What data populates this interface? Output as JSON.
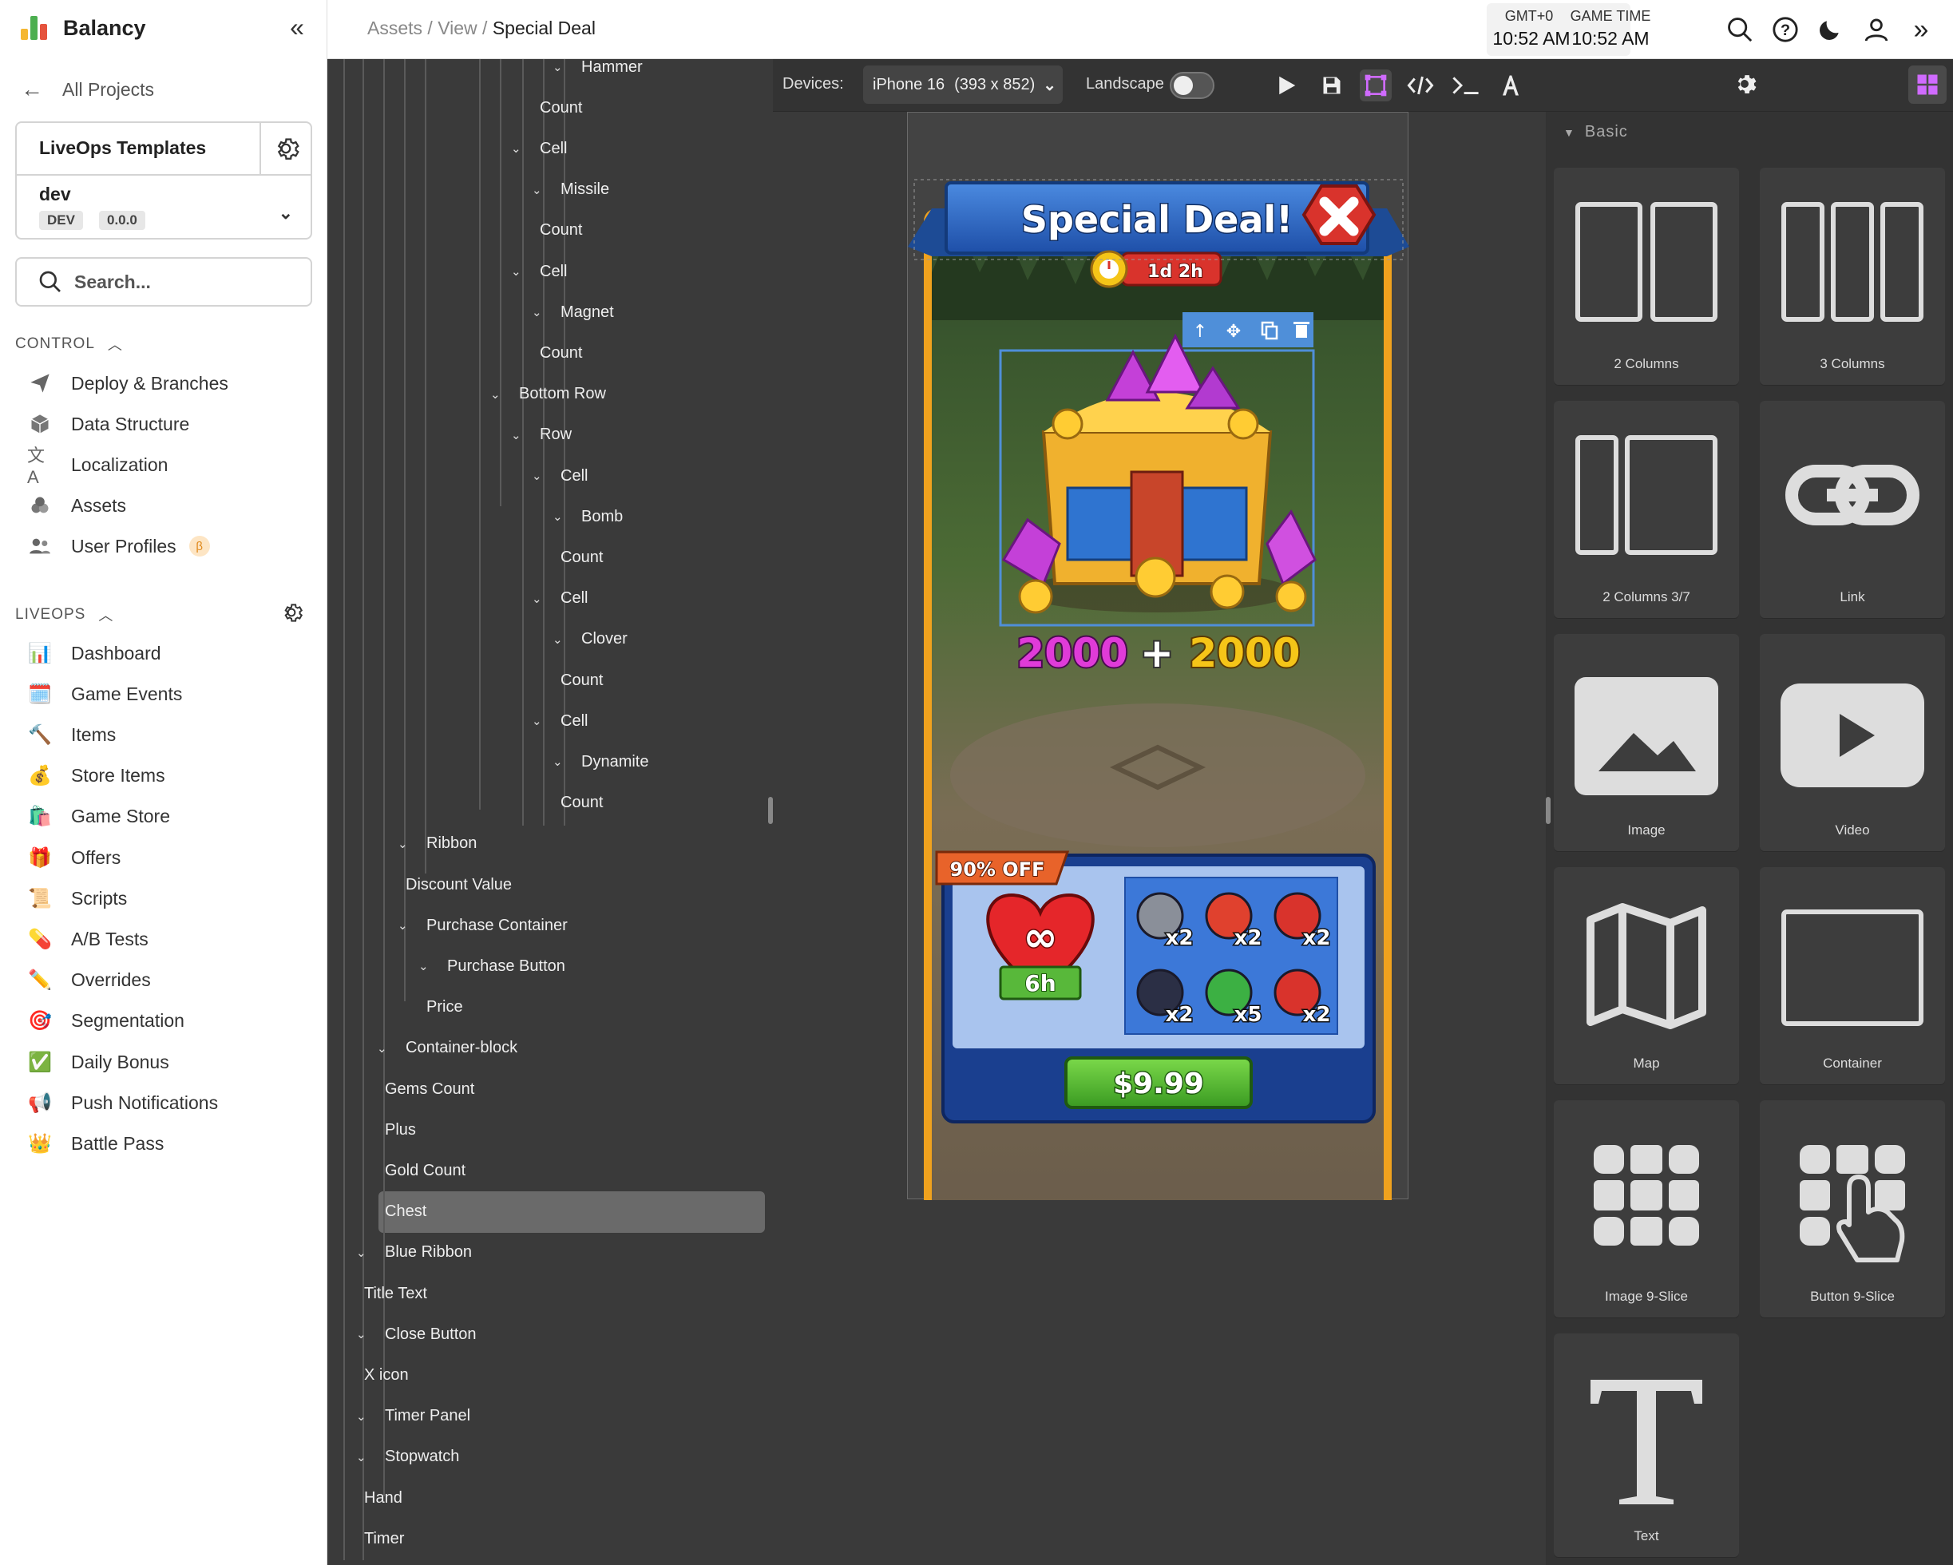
{
  "brand": {
    "name": "Balancy"
  },
  "sidebar": {
    "back_label": "All Projects",
    "project_name": "LiveOps Templates",
    "env_name": "dev",
    "env_badge": "DEV",
    "version_badge": "0.0.0",
    "search_placeholder": "Search...",
    "control_title": "CONTROL",
    "control_items": [
      {
        "label": "Deploy & Branches",
        "icon": "send-icon"
      },
      {
        "label": "Data Structure",
        "icon": "cube-icon"
      },
      {
        "label": "Localization",
        "icon": "translate-icon"
      },
      {
        "label": "Assets",
        "icon": "assets-icon"
      },
      {
        "label": "User Profiles",
        "icon": "users-icon",
        "beta": "β"
      }
    ],
    "liveops_title": "LIVEOPS",
    "liveops_items": [
      {
        "label": "Dashboard",
        "icon": "📊"
      },
      {
        "label": "Game Events",
        "icon": "🗓️"
      },
      {
        "label": "Items",
        "icon": "🔨"
      },
      {
        "label": "Store Items",
        "icon": "💰"
      },
      {
        "label": "Game Store",
        "icon": "🛍️"
      },
      {
        "label": "Offers",
        "icon": "🎁"
      },
      {
        "label": "Scripts",
        "icon": "📜"
      },
      {
        "label": "A/B Tests",
        "icon": "💊"
      },
      {
        "label": "Overrides",
        "icon": "✏️"
      },
      {
        "label": "Segmentation",
        "icon": "🎯"
      },
      {
        "label": "Daily Bonus",
        "icon": "✅"
      },
      {
        "label": "Push Notifications",
        "icon": "📢"
      },
      {
        "label": "Battle Pass",
        "icon": "👑"
      }
    ]
  },
  "topbar": {
    "breadcrumb": [
      "Assets",
      "View",
      "Special Deal"
    ],
    "tz_label": "GMT+0",
    "tz_time": "10:52 AM",
    "game_label": "GAME TIME",
    "game_time": "10:52 AM"
  },
  "tree": {
    "nodes": [
      {
        "label": "Hammer",
        "chev": true
      },
      {
        "label": "Count",
        "chev": false
      },
      {
        "label": "Cell",
        "chev": true
      },
      {
        "label": "Missile",
        "chev": true
      },
      {
        "label": "Count",
        "chev": false
      },
      {
        "label": "Cell",
        "chev": true
      },
      {
        "label": "Magnet",
        "chev": true
      },
      {
        "label": "Count",
        "chev": false
      },
      {
        "label": "Bottom Row",
        "chev": true
      },
      {
        "label": "Row",
        "chev": true
      },
      {
        "label": "Cell",
        "chev": true
      },
      {
        "label": "Bomb",
        "chev": true
      },
      {
        "label": "Count",
        "chev": false
      },
      {
        "label": "Cell",
        "chev": true
      },
      {
        "label": "Clover",
        "chev": true
      },
      {
        "label": "Count",
        "chev": false
      },
      {
        "label": "Cell",
        "chev": true
      },
      {
        "label": "Dynamite",
        "chev": true
      },
      {
        "label": "Count",
        "chev": false
      },
      {
        "label": "Ribbon",
        "chev": true
      },
      {
        "label": "Discount Value",
        "chev": false
      },
      {
        "label": "Purchase Container",
        "chev": true
      },
      {
        "label": "Purchase Button",
        "chev": true
      },
      {
        "label": "Price",
        "chev": false
      },
      {
        "label": "Container-block",
        "chev": true
      },
      {
        "label": "Gems Count",
        "chev": false
      },
      {
        "label": "Plus",
        "chev": false
      },
      {
        "label": "Gold Count",
        "chev": false
      },
      {
        "label": "Chest",
        "chev": false,
        "selected": true
      },
      {
        "label": "Blue Ribbon",
        "chev": true
      },
      {
        "label": "Title Text",
        "chev": false
      },
      {
        "label": "Close Button",
        "chev": true
      },
      {
        "label": "X icon",
        "chev": false
      },
      {
        "label": "Timer Panel",
        "chev": true
      },
      {
        "label": "Stopwatch",
        "chev": true
      },
      {
        "label": "Hand",
        "chev": false
      },
      {
        "label": "Timer",
        "chev": false
      }
    ]
  },
  "canvas": {
    "devices_label": "Devices:",
    "device": "iPhone 16",
    "device_res": "(393 x 852)",
    "landscape_label": "Landscape",
    "landscape_on": false
  },
  "game": {
    "title": "Special Deal!",
    "timer": "1d 2h",
    "gems_count": "2000",
    "plus": "+",
    "gold_count": "2000",
    "discount": "90% OFF",
    "lives": "6h",
    "items": [
      {
        "name": "Hammer",
        "count": "x2"
      },
      {
        "name": "Missile",
        "count": "x2"
      },
      {
        "name": "Magnet",
        "count": "x2"
      },
      {
        "name": "Bomb",
        "count": "x2"
      },
      {
        "name": "Clover",
        "count": "x5"
      },
      {
        "name": "Dynamite",
        "count": "x2"
      }
    ],
    "price": "$9.99"
  },
  "components": {
    "section": "Basic",
    "items": [
      "2 Columns",
      "3 Columns",
      "2 Columns 3/7",
      "Link",
      "Image",
      "Video",
      "Map",
      "Container",
      "Image 9-Slice",
      "Button 9-Slice",
      "Text"
    ]
  },
  "colors": {
    "accent": "#4f8fd9",
    "selected_row": "#6a6a6a",
    "price_green": "#4caf2f",
    "gem_pink": "#e03bd8",
    "gold": "#f5c518"
  }
}
